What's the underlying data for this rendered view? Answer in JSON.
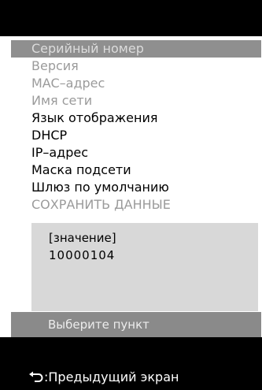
{
  "menu": {
    "items": [
      {
        "label": "Серийный номер",
        "state": "selected"
      },
      {
        "label": "Версия",
        "state": "disabled"
      },
      {
        "label": "MAC–адрес",
        "state": "disabled"
      },
      {
        "label": "Имя сети",
        "state": "disabled"
      },
      {
        "label": "Язык отображения",
        "state": "enabled"
      },
      {
        "label": "DHCP",
        "state": "enabled"
      },
      {
        "label": "IP–адрес",
        "state": "enabled"
      },
      {
        "label": "Маска подсети",
        "state": "enabled"
      },
      {
        "label": "Шлюз по умолчанию",
        "state": "enabled"
      },
      {
        "label": "СОХРАНИТЬ ДАННЫЕ",
        "state": "disabled"
      }
    ]
  },
  "value_box": {
    "label": "[значение]",
    "value": "10000104"
  },
  "hint": {
    "text": "Выберите пункт"
  },
  "footer": {
    "back_label": ":Предыдущий экран",
    "back_icon": "return-arrow-icon"
  },
  "colors": {
    "bars": "#000000",
    "selected_row": "#8f8f8f",
    "selected_text": "#dcdcdc",
    "disabled_text": "#9b9b9b",
    "value_box": "#d8d8d8",
    "hint_bar": "#8a8a8a"
  }
}
